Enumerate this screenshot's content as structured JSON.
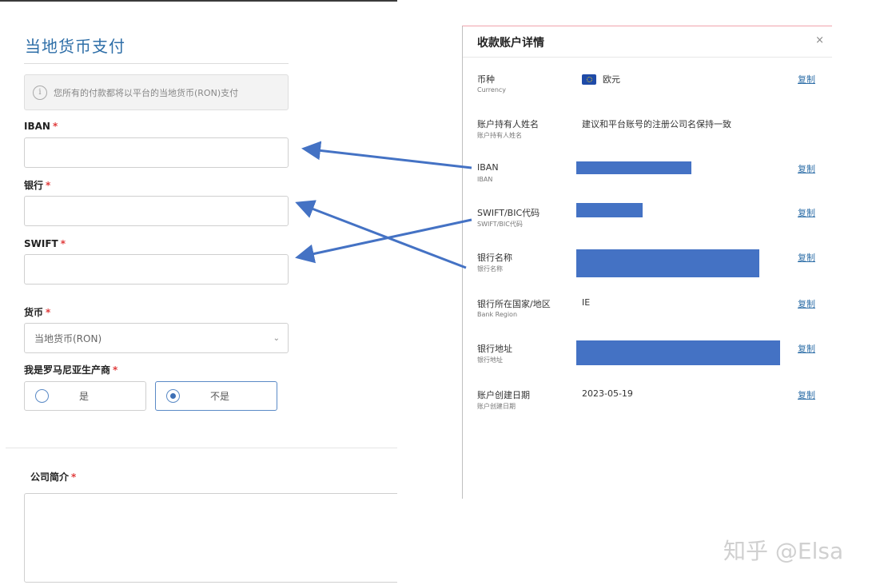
{
  "form": {
    "title": "当地货币支付",
    "notice": "您所有的付款都将以平台的当地货币(RON)支付",
    "required_mark": "*",
    "iban_label": "IBAN",
    "bank_label": "银行",
    "swift_label": "SWIFT",
    "currency_label": "货币",
    "currency_value": "当地货币(RON)",
    "producer_label": "我是罗马尼亚生产商",
    "producer_options": [
      "是",
      "不是"
    ],
    "producer_selected": "不是",
    "company_intro_label": "公司简介"
  },
  "panel": {
    "title": "收款账户详情",
    "close": "×",
    "copy_label": "复制",
    "rows": [
      {
        "label": "币种",
        "sub": "Currency",
        "value": "欧元",
        "copy": true
      },
      {
        "label": "账户持有人姓名",
        "sub": "账户持有人姓名",
        "value": "建议和平台账号的注册公司名保持一致",
        "copy": false
      },
      {
        "label": "IBAN",
        "sub": "IBAN",
        "value": "",
        "copy": true
      },
      {
        "label": "SWIFT/BIC代码",
        "sub": "SWIFT/BIC代码",
        "value": "",
        "copy": true
      },
      {
        "label": "银行名称",
        "sub": "银行名称",
        "value": "",
        "copy": true
      },
      {
        "label": "银行所在国家/地区",
        "sub": "Bank Region",
        "value": "IE",
        "copy": true
      },
      {
        "label": "银行地址",
        "sub": "银行地址",
        "value": "",
        "copy": true
      },
      {
        "label": "账户创建日期",
        "sub": "账户创建日期",
        "value": "2023-05-19",
        "copy": true
      }
    ]
  },
  "watermark": "知乎 @Elsa",
  "colors": {
    "accent": "#2f6fa8",
    "required": "#e03c3c",
    "redaction": "#4472c4",
    "arrow": "#4472c4"
  }
}
